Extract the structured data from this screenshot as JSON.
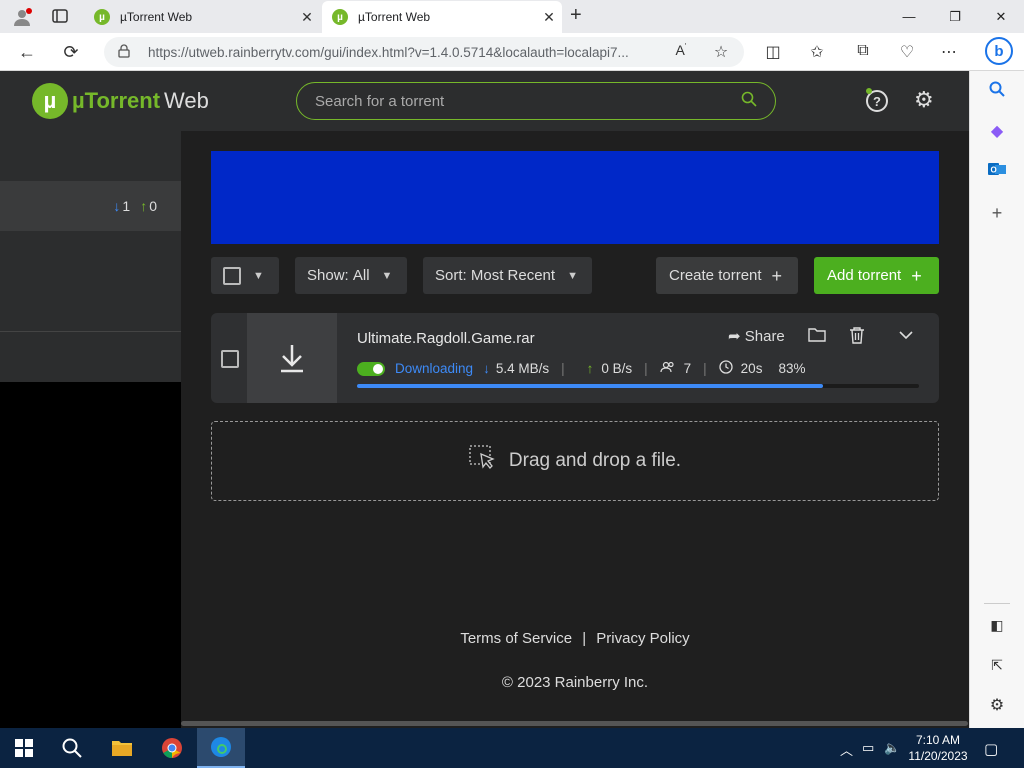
{
  "browser": {
    "tabs": [
      {
        "title": "µTorrent Web",
        "active": false
      },
      {
        "title": "µTorrent Web",
        "active": true
      }
    ],
    "new_tab": "+",
    "url": "https://utweb.rainberrytv.com/gui/index.html?v=1.4.0.5714&localauth=localapi7...",
    "window_controls": {
      "minimize": "—",
      "restore": "❐",
      "close": "✕"
    }
  },
  "app": {
    "logo_mu": "µTorrent",
    "logo_web": "Web",
    "search_placeholder": "Search for a torrent",
    "help_icon": "?",
    "left_panel": {
      "down_count": "1",
      "up_count": "0"
    },
    "controls": {
      "show_label": "Show:",
      "show_value": "All",
      "sort_label": "Sort:",
      "sort_value": "Most Recent",
      "create_torrent": "Create torrent",
      "add_torrent": "Add torrent"
    },
    "torrent": {
      "name": "Ultimate.Ragdoll.Game.rar",
      "share_label": "Share",
      "status": "Downloading",
      "down_speed": "5.4 MB/s",
      "up_speed": "0 B/s",
      "peers": "7",
      "eta": "20s",
      "progress_text": "83%",
      "progress": 0.83
    },
    "dropzone_text": "Drag and drop a file.",
    "footer": {
      "terms": "Terms of Service",
      "separator": "|",
      "privacy": "Privacy Policy",
      "copyright": "© 2023 Rainberry Inc."
    }
  },
  "taskbar": {
    "time": "7:10 AM",
    "date": "11/20/2023"
  },
  "colors": {
    "brand_green": "#76b82a",
    "accent_blue": "#3d8af7",
    "banner_blue": "#0028c8"
  }
}
